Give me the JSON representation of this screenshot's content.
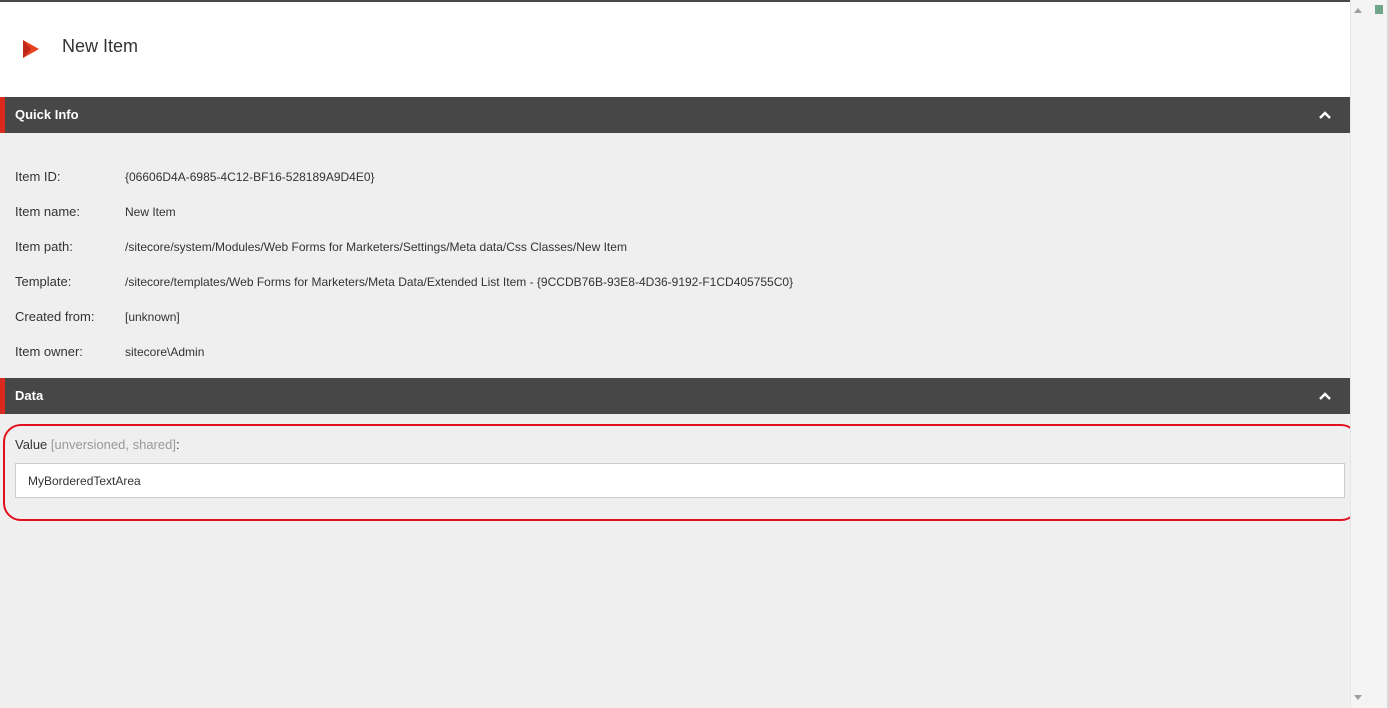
{
  "header": {
    "title": "New Item",
    "logo_icon": "sitecore-play-logo-icon",
    "logo_color": "#e8401c"
  },
  "quick_info": {
    "title": "Quick Info",
    "collapse_icon": "chevron-up-icon",
    "rows": [
      {
        "label": "Item ID:",
        "value": "{06606D4A-6985-4C12-BF16-528189A9D4E0}"
      },
      {
        "label": "Item name:",
        "value": "New Item"
      },
      {
        "label": "Item path:",
        "value": "/sitecore/system/Modules/Web Forms for Marketers/Settings/Meta data/Css Classes/New Item"
      },
      {
        "label": "Template:",
        "value": "/sitecore/templates/Web Forms for Marketers/Meta Data/Extended List Item - {9CCDB76B-93E8-4D36-9192-F1CD405755C0}"
      },
      {
        "label": "Created from:",
        "value": "[unknown]"
      },
      {
        "label": "Item owner:",
        "value": "sitecore\\Admin"
      }
    ]
  },
  "data_section": {
    "title": "Data",
    "collapse_icon": "chevron-up-icon",
    "field": {
      "label": "Value",
      "meta": "[unversioned, shared]",
      "suffix": ":",
      "value": "MyBorderedTextArea"
    }
  },
  "colors": {
    "accent": "#dc291e",
    "section_bar": "#474747",
    "highlight": "#e0101e",
    "background": "#efefef"
  }
}
